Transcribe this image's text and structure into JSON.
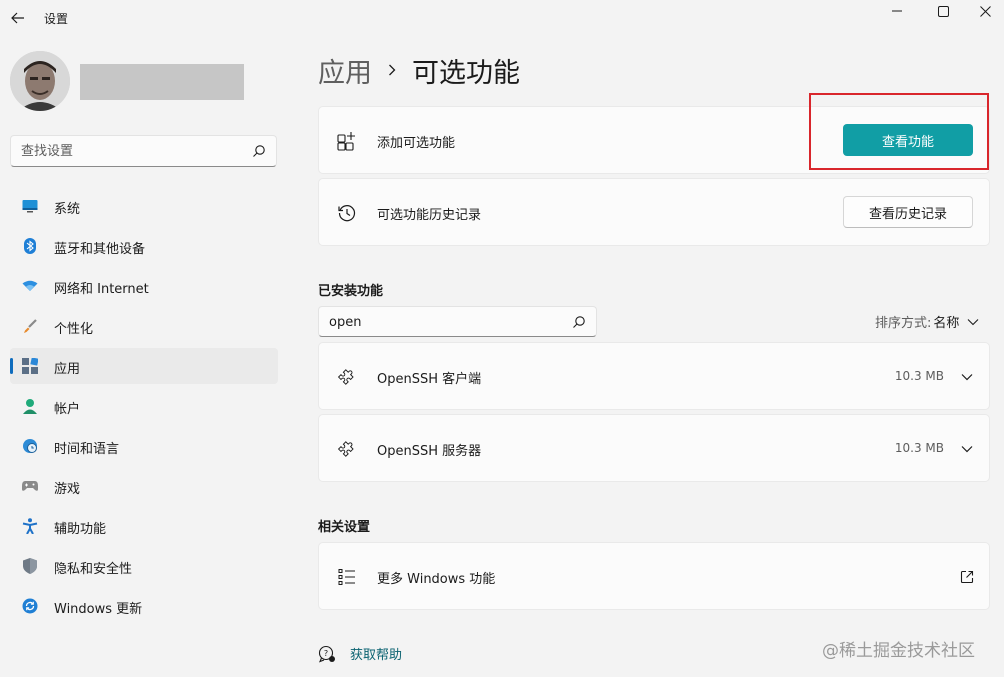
{
  "window": {
    "title": "设置"
  },
  "user": {
    "avatar_icon": "user-avatar"
  },
  "search": {
    "placeholder": "查找设置"
  },
  "sidebar": {
    "items": [
      {
        "label": "系统",
        "icon": "monitor-icon"
      },
      {
        "label": "蓝牙和其他设备",
        "icon": "bluetooth-icon"
      },
      {
        "label": "网络和 Internet",
        "icon": "wifi-icon"
      },
      {
        "label": "个性化",
        "icon": "brush-icon"
      },
      {
        "label": "应用",
        "icon": "apps-icon",
        "selected": true
      },
      {
        "label": "帐户",
        "icon": "account-icon"
      },
      {
        "label": "时间和语言",
        "icon": "globe-clock-icon"
      },
      {
        "label": "游戏",
        "icon": "gamepad-icon"
      },
      {
        "label": "辅助功能",
        "icon": "accessibility-icon"
      },
      {
        "label": "隐私和安全性",
        "icon": "shield-icon"
      },
      {
        "label": "Windows 更新",
        "icon": "update-icon"
      }
    ]
  },
  "breadcrumb": {
    "parent": "应用",
    "current": "可选功能"
  },
  "add_feature": {
    "label": "添加可选功能",
    "button": "查看功能"
  },
  "history": {
    "label": "可选功能历史记录",
    "button": "查看历史记录"
  },
  "installed": {
    "title": "已安装功能",
    "search_value": "open",
    "sort_label": "排序方式:",
    "sort_value": "名称",
    "items": [
      {
        "name": "OpenSSH 客户端",
        "size": "10.3 MB"
      },
      {
        "name": "OpenSSH 服务器",
        "size": "10.3 MB"
      }
    ]
  },
  "related": {
    "title": "相关设置",
    "items": [
      {
        "label": "更多 Windows 功能"
      }
    ]
  },
  "help": {
    "label": "获取帮助"
  },
  "watermark": "@稀土掘金技术社区",
  "colors": {
    "accent": "#119ea5",
    "selection_bar": "#0f6cbd",
    "highlight": "#d9262c"
  }
}
